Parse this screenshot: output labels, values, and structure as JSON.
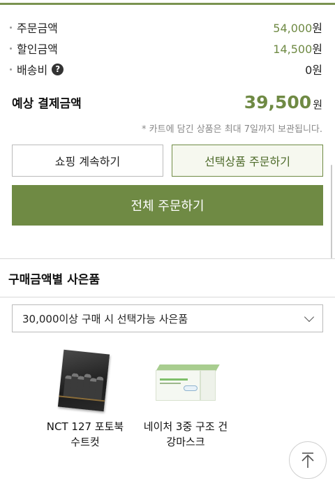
{
  "summary": {
    "rows": [
      {
        "label": "주문금액",
        "amount": "54,000",
        "unit": "원"
      },
      {
        "label": "할인금액",
        "amount": "14,500",
        "unit": "원"
      },
      {
        "label": "배송비",
        "amount": "0",
        "unit": "원"
      }
    ],
    "help_icon": "?"
  },
  "total": {
    "label": "예상 결제금액",
    "amount": "39,500",
    "unit": "원"
  },
  "notice": "* 카트에 담긴 상품은 최대 7일까지 보관됩니다.",
  "buttons": {
    "continue_shopping": "쇼핑 계속하기",
    "order_selected": "선택상품 주문하기",
    "order_all": "전체 주문하기"
  },
  "gifts": {
    "title": "구매금액별 사은품",
    "select_value": "30,000이상 구매 시 선택가능 사은품",
    "items": [
      {
        "name_line1": "NCT 127 포토북",
        "name_line2": "수트컷",
        "icon": "photobook-image"
      },
      {
        "name_line1": "네이처 3중 구조 건",
        "name_line2": "강마스크",
        "icon": "mask-box-image"
      }
    ]
  },
  "colors": {
    "accent": "#6f8a44",
    "accent_light_bg": "#f6f8ef",
    "border": "#bbbbbb"
  }
}
